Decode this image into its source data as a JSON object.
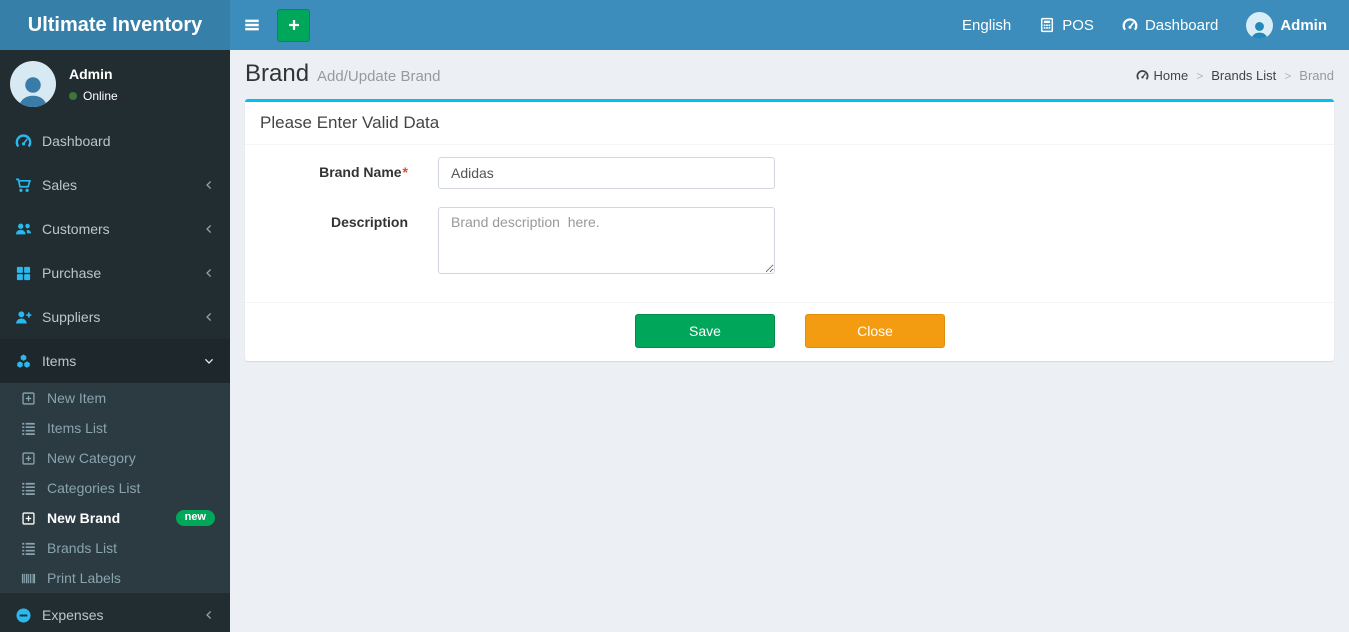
{
  "colors": {
    "navbar_bg": "#3c8dbc",
    "logo_bg": "#367fa9",
    "sidebar_bg": "#222d32",
    "submenu_bg": "#2c3b41",
    "active_item_bg": "#1e282c",
    "accent_cyan": "#00c0ef",
    "icon_blue": "#29b9ef",
    "success_green": "#00a65a",
    "warning_orange": "#f39c12",
    "body_bg": "#ecf0f5",
    "online_dot_green": "#3c763d",
    "required_red": "#dd4b39"
  },
  "navbar": {
    "brand": "Ultimate Inventory",
    "language_label": "English",
    "pos_label": "POS",
    "dashboard_label": "Dashboard",
    "user_label": "Admin"
  },
  "sidebar": {
    "user": {
      "name": "Admin",
      "status": "Online"
    },
    "items": [
      {
        "label": "Dashboard",
        "icon": "tachometer-icon"
      },
      {
        "label": "Sales",
        "icon": "shopping-cart-icon",
        "chevron": "left"
      },
      {
        "label": "Customers",
        "icon": "users-icon",
        "chevron": "left"
      },
      {
        "label": "Purchase",
        "icon": "grid-icon",
        "chevron": "left"
      },
      {
        "label": "Suppliers",
        "icon": "user-plus-icon",
        "chevron": "left"
      },
      {
        "label": "Items",
        "icon": "cubes-icon",
        "chevron": "down",
        "active": true,
        "children": [
          {
            "label": "New Item",
            "icon": "plus-square-icon"
          },
          {
            "label": "Items List",
            "icon": "list-icon"
          },
          {
            "label": "New Category",
            "icon": "plus-square-icon"
          },
          {
            "label": "Categories List",
            "icon": "list-icon"
          },
          {
            "label": "New Brand",
            "icon": "plus-square-icon",
            "active": true,
            "badge": "new"
          },
          {
            "label": "Brands List",
            "icon": "list-icon"
          },
          {
            "label": "Print Labels",
            "icon": "barcode-icon"
          }
        ]
      },
      {
        "label": "Expenses",
        "icon": "minus-circle-icon",
        "chevron": "left"
      }
    ]
  },
  "content": {
    "title": "Brand",
    "subtitle": "Add/Update Brand",
    "breadcrumb": {
      "home": "Home",
      "parent": "Brands List",
      "current": "Brand",
      "separator": ">"
    },
    "panel": {
      "heading": "Please Enter Valid Data",
      "required_mark": "*",
      "fields": [
        {
          "label": "Brand Name",
          "value": "Adidas"
        },
        {
          "label": "Description",
          "placeholder": "Brand description  here."
        }
      ],
      "buttons": {
        "save": "Save",
        "close": "Close"
      }
    }
  }
}
